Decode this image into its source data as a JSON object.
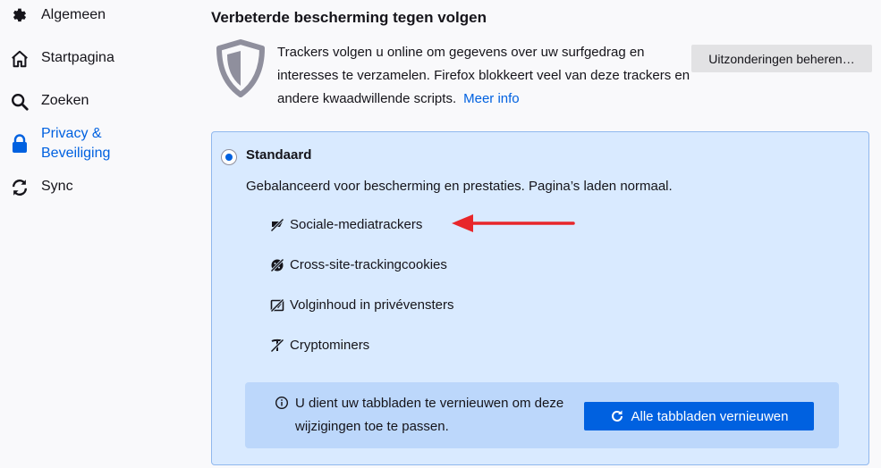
{
  "sidebar": {
    "items": [
      {
        "label": "Algemeen",
        "icon": "gear-icon"
      },
      {
        "label": "Startpagina",
        "icon": "home-icon"
      },
      {
        "label": "Zoeken",
        "icon": "search-icon"
      },
      {
        "label": "Privacy &\nBeveiliging",
        "icon": "lock-icon",
        "active": true
      },
      {
        "label": "Sync",
        "icon": "sync-icon"
      }
    ]
  },
  "main": {
    "title": "Verbeterde bescherming tegen volgen",
    "intro_text": "Trackers volgen u online om gegevens over uw surfgedrag en interesses te verzamelen. Firefox blokkeert veel van deze trackers en andere kwaadwillende scripts.",
    "more_info_link": "Meer info",
    "exceptions_button": "Uitzonderingen beheren…",
    "standard": {
      "selected": true,
      "title": "Standaard",
      "description": "Gebalanceerd voor bescherming en prestaties. Pagina’s laden normaal.",
      "features": [
        {
          "label": "Sociale-mediatrackers",
          "icon": "social-tracker-blocked-icon"
        },
        {
          "label": "Cross-site-trackingcookies",
          "icon": "cookie-blocked-icon"
        },
        {
          "label": "Volginhoud in privévensters",
          "icon": "tracking-content-blocked-icon"
        },
        {
          "label": "Cryptominers",
          "icon": "cryptominer-blocked-icon"
        }
      ]
    },
    "notice": {
      "message": "U dient uw tabbladen te vernieuwen om deze wijzigingen toe te passen.",
      "button": "Alle tabbladen vernieuwen"
    }
  },
  "colors": {
    "accent": "#0061e0",
    "card_bg": "#d9eaff",
    "notice_bg": "#bcd7fb",
    "annotation_arrow": "#e8262a"
  }
}
